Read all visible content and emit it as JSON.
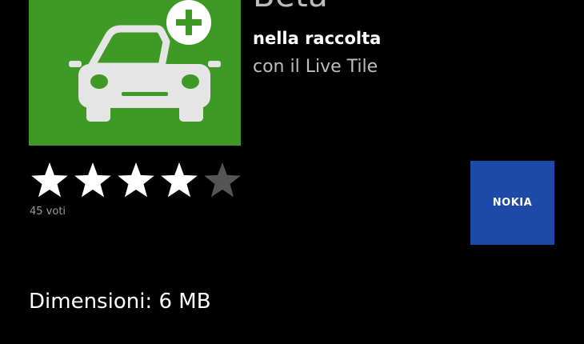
{
  "app": {
    "title": "Beta",
    "subtitle": "nella raccolta",
    "subline": "con il Live Tile",
    "tile_color": "#3f9a25",
    "icon": "car-plus-icon"
  },
  "rating": {
    "stars_filled": 4,
    "stars_total": 5,
    "votes_label": "45 voti",
    "filled_color": "#ffffff",
    "empty_color": "#555555"
  },
  "publisher": {
    "logo_text": "NOKIA",
    "color": "#1d4aa8"
  },
  "details": {
    "size_label": "Dimensioni: 6 MB"
  }
}
